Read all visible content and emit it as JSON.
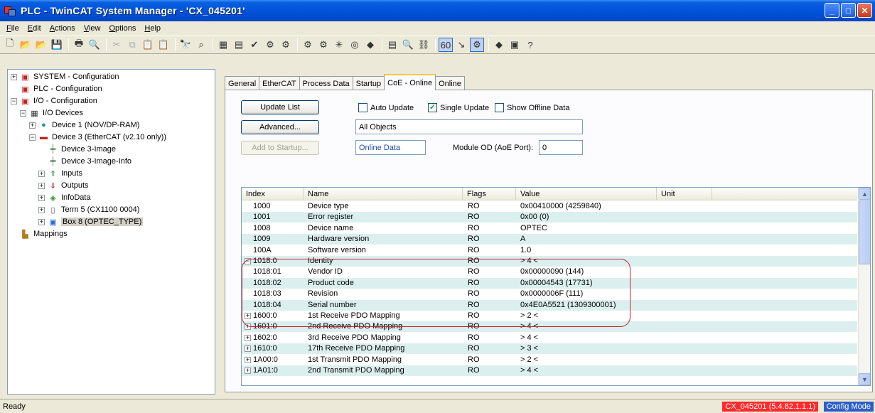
{
  "window": {
    "title": "PLC - TwinCAT System Manager - 'CX_045201'"
  },
  "menu": [
    "File",
    "Edit",
    "Actions",
    "View",
    "Options",
    "Help"
  ],
  "tree": {
    "system": "SYSTEM - Configuration",
    "plc": "PLC - Configuration",
    "io": "I/O - Configuration",
    "io_devices": "I/O Devices",
    "device1": "Device 1 (NOV/DP-RAM)",
    "device3": "Device 3 (EtherCAT (v2.10 only))",
    "device3_image": "Device 3-Image",
    "device3_image_info": "Device 3-Image-Info",
    "inputs": "Inputs",
    "outputs": "Outputs",
    "infodata": "InfoData",
    "term5": "Term 5 (CX1100 0004)",
    "box8": "Box 8 (OPTEC_TYPE)",
    "mappings": "Mappings"
  },
  "tabs": [
    "General",
    "EtherCAT",
    "Process Data",
    "Startup",
    "CoE - Online",
    "Online"
  ],
  "coe": {
    "update_list": "Update List",
    "auto_update": "Auto Update",
    "single_update": "Single Update",
    "show_offline": "Show Offline Data",
    "advanced": "Advanced...",
    "all_objects": "All Objects",
    "add_to_startup": "Add to Startup...",
    "online_data": "Online Data",
    "module_od_label": "Module OD (AoE Port):",
    "module_od_value": "0"
  },
  "columns": [
    "Index",
    "Name",
    "Flags",
    "Value",
    "Unit"
  ],
  "rows": [
    {
      "index": "1000",
      "name": "Device type",
      "flags": "RO",
      "value": "0x00410000 (4259840)"
    },
    {
      "index": "1001",
      "name": "Error register",
      "flags": "RO",
      "value": "0x00 (0)"
    },
    {
      "index": "1008",
      "name": "Device name",
      "flags": "RO",
      "value": "OPTEC"
    },
    {
      "index": "1009",
      "name": "Hardware version",
      "flags": "RO",
      "value": "A"
    },
    {
      "index": "100A",
      "name": "Software version",
      "flags": "RO",
      "value": "1.0"
    },
    {
      "index": "1018:0",
      "name": "Identity",
      "flags": "RO",
      "value": "> 4 <"
    },
    {
      "index": "1018:01",
      "name": "Vendor ID",
      "flags": "RO",
      "value": "0x00000090 (144)"
    },
    {
      "index": "1018:02",
      "name": "Product code",
      "flags": "RO",
      "value": "0x00004543 (17731)"
    },
    {
      "index": "1018:03",
      "name": "Revision",
      "flags": "RO",
      "value": "0x0000006F (111)"
    },
    {
      "index": "1018:04",
      "name": "Serial number",
      "flags": "RO",
      "value": "0x4E0A5521 (1309300001)"
    },
    {
      "index": "1600:0",
      "name": "1st Receive PDO Mapping",
      "flags": "RO",
      "value": "> 2 <"
    },
    {
      "index": "1601:0",
      "name": "2nd Receive PDO Mapping",
      "flags": "RO",
      "value": "> 4 <"
    },
    {
      "index": "1602:0",
      "name": "3rd Receive PDO Mapping",
      "flags": "RO",
      "value": "> 4 <"
    },
    {
      "index": "1610:0",
      "name": "17th Receive PDO Mapping",
      "flags": "RO",
      "value": "> 3 <"
    },
    {
      "index": "1A00:0",
      "name": "1st Transmit PDO Mapping",
      "flags": "RO",
      "value": "> 2 <"
    },
    {
      "index": "1A01:0",
      "name": "2nd Transmit PDO Mapping",
      "flags": "RO",
      "value": "> 4 <"
    }
  ],
  "status": {
    "left": "Ready",
    "target": "CX_045201 (5.4.82.1.1.1)",
    "mode": "Config Mode"
  }
}
